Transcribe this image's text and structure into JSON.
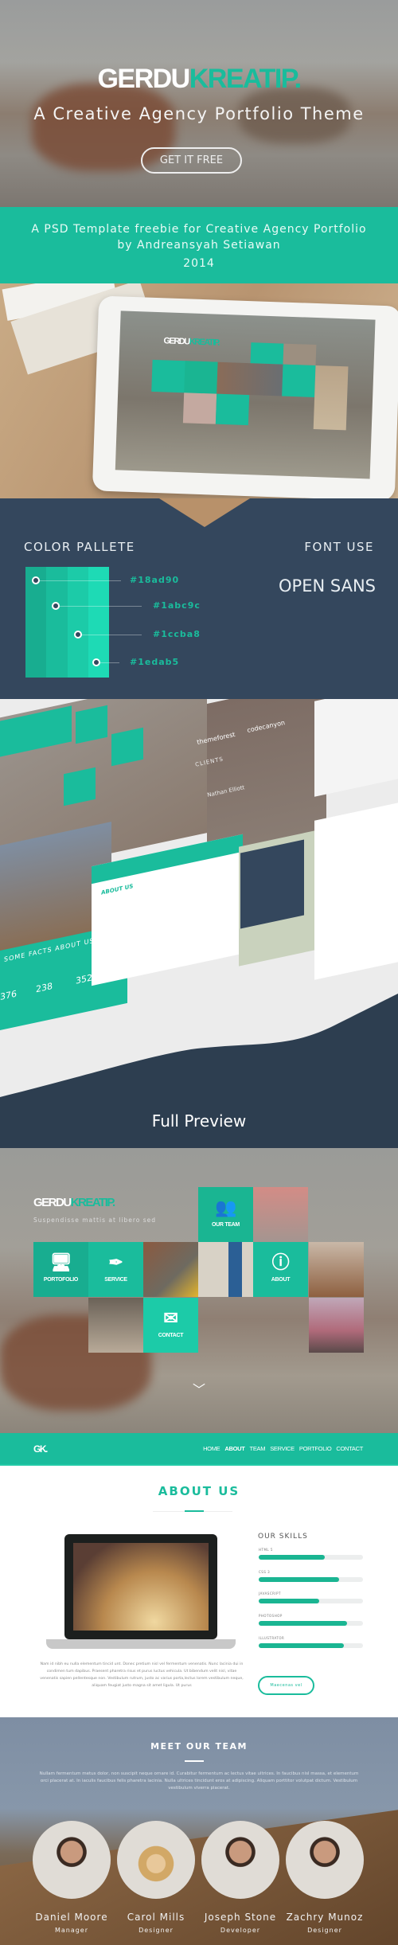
{
  "hero": {
    "logo_part1": "GERDU",
    "logo_part2": "KREATIP.",
    "tagline": "A Creative Agency Portfolio Theme",
    "cta": "GET IT FREE"
  },
  "band": {
    "line1": "A PSD Template freebie for Creative Agency Portfolio",
    "line2": "by Andreansyah Setiawan",
    "year": "2014"
  },
  "palette": {
    "title": "COLOR PALLETE",
    "colors": [
      "#18ad90",
      "#1abc9c",
      "#1ccba8",
      "#1edab5"
    ],
    "font_title": "FONT USE",
    "font_name": "OPEN SANS"
  },
  "collage": {
    "stats": [
      "376",
      "238",
      "352"
    ],
    "heading": "SOME FACTS ABOUT US",
    "names": [
      "Joseph Stone",
      "Zachry Munoz"
    ],
    "brands": [
      "themeforest",
      "codecanyon"
    ],
    "clients": "CLIENTS",
    "testimonial_name": "Nathan Elliott",
    "about": "ABOUT US"
  },
  "full_preview": {
    "title": "Full Preview"
  },
  "preview": {
    "logo_part1": "GERDU",
    "logo_part2": "KREATIP.",
    "subtitle": "Suspendisse mattis at libero sed",
    "tiles": [
      {
        "label": "OUR TEAM",
        "icon": "users-icon"
      },
      {
        "label": "PORTOFOLIO",
        "icon": "monitor-icon"
      },
      {
        "label": "SERVICE",
        "icon": "pen-icon"
      },
      {
        "label": "ABOUT",
        "icon": "info-icon"
      },
      {
        "label": "CONTACT",
        "icon": "envelope-icon"
      }
    ]
  },
  "nav": {
    "logo": "GK.",
    "items": [
      "HOME",
      "ABOUT",
      "TEAM",
      "SERVICE",
      "PORTFOLIO",
      "CONTACT"
    ],
    "active": "ABOUT"
  },
  "about": {
    "title": "ABOUT US",
    "skills_title": "OUR SKILLS",
    "skills": [
      {
        "name": "HTML 5",
        "percent": 63
      },
      {
        "name": "CSS 3",
        "percent": 77
      },
      {
        "name": "JAVASCRIPT",
        "percent": 58
      },
      {
        "name": "PHOTOSHOP",
        "percent": 85
      },
      {
        "name": "ILLUSTRATOR",
        "percent": 82
      }
    ],
    "paragraph": "Nam id nibh eu nulla elementum tincid unt. Donec pretium nisl vel fermentum venenatis. Nunc lacinia dui in condimen tum dapibus. Praesent pharetra risus et purus luctus vehicula. Ut bibendum velit nisl, vitae venenatis sapien pellentesque non. Vestibulum rutrum, justo ac varius porta,lectus lorem vestibulum neque, aliquam feugiat justo magna sit amet ligula. Ut purus",
    "button": "Maecenas vel"
  },
  "team": {
    "title": "MEET OUR TEAM",
    "paragraph": "Nullam fermentum metus dolor, non suscipit neque ornare id. Curabitur fermentum ac lectus vitae ultrices. In faucibus nisl massa, et elementum orci placerat at. In iaculis faucibus felis pharetra lacinia. Nulla ultrices tincidunt eros at adipiscing. Aliquam porttitor volutpat dictum. Vestibulum vestibulum viverra placerat.",
    "members": [
      {
        "name": "Daniel Moore",
        "role": "Manager"
      },
      {
        "name": "Carol Mills",
        "role": "Designer"
      },
      {
        "name": "Joseph Stone",
        "role": "Developer"
      },
      {
        "name": "Zachry Munoz",
        "role": "Designer"
      }
    ]
  },
  "accent": "#1abc9c",
  "navy": "#34475d"
}
